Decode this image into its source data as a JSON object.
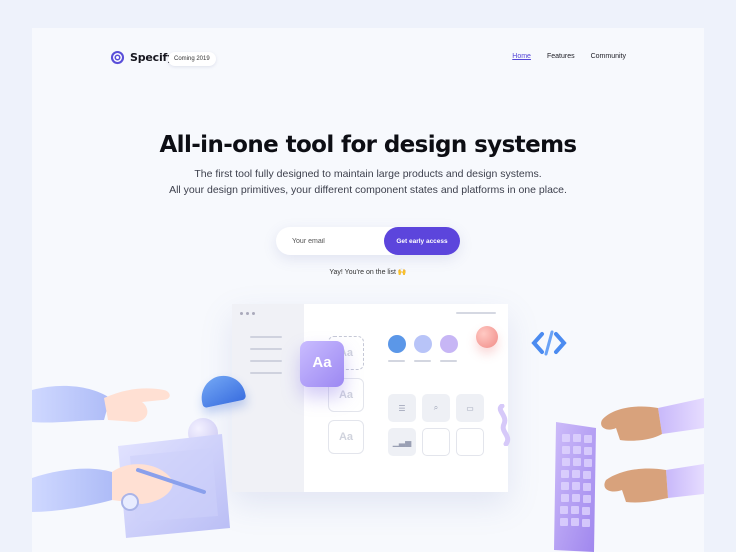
{
  "brand": {
    "name": "Specify",
    "badge": "Coming 2019",
    "accent": "#5c45dc"
  },
  "nav": {
    "items": [
      {
        "label": "Home",
        "active": true
      },
      {
        "label": "Features",
        "active": false
      },
      {
        "label": "Community",
        "active": false
      }
    ]
  },
  "hero": {
    "title": "All-in-one tool for design systems",
    "subtitle_line1": "The first tool fully designed to maintain large products and design systems.",
    "subtitle_line2": "All your design primitives, your different component states and platforms in one place."
  },
  "signup": {
    "email_placeholder": "Your email",
    "button_label": "Get early access",
    "success_message": "Yay! You're on the list 🙌"
  },
  "illustration": {
    "typography_tile": "Aa",
    "placeholder_tiles": [
      "Aa",
      "Aa",
      "Aa"
    ],
    "color_swatches": [
      "#5b97e8",
      "#b8c4f8",
      "#c7b6f5",
      "#f5a5a0"
    ],
    "component_icons": [
      "list-icon",
      "search-icon",
      "toggle-icon",
      "signal-icon"
    ]
  }
}
